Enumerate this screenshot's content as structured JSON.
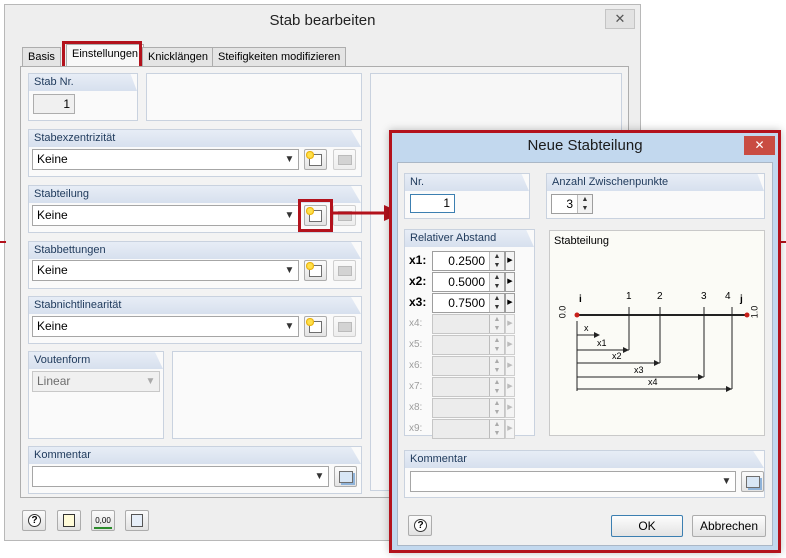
{
  "main_window": {
    "title": "Stab bearbeiten",
    "tabs": [
      {
        "label": "Basis"
      },
      {
        "label": "Einstellungen"
      },
      {
        "label": "Knicklängen"
      },
      {
        "label": "Steifigkeiten modifizieren"
      }
    ],
    "stab_nr": {
      "label": "Stab Nr.",
      "value": "1"
    },
    "stabexzentrizitaet": {
      "label": "Stabexzentrizität",
      "value": "Keine"
    },
    "stabteilung": {
      "label": "Stabteilung",
      "value": "Keine"
    },
    "stabbettungen": {
      "label": "Stabbettungen",
      "value": "Keine"
    },
    "stabnichtlinearitaet": {
      "label": "Stabnichtlinearität",
      "value": "Keine"
    },
    "voutenform": {
      "label": "Voutenform",
      "value": "Linear"
    },
    "kommentar": {
      "label": "Kommentar",
      "value": ""
    },
    "bottom_icons": [
      "help-icon",
      "edit-icon",
      "number-format-icon",
      "pick-icon"
    ],
    "bottom_icon_text": {
      "number_format": "0,00"
    }
  },
  "sub_dialog": {
    "title": "Neue Stabteilung",
    "nr": {
      "label": "Nr.",
      "value": "1"
    },
    "anzahl": {
      "label": "Anzahl Zwischenpunkte",
      "value": "3"
    },
    "relativer_abstand": {
      "label": "Relativer Abstand",
      "rows": [
        {
          "label": "x1:",
          "value": "0.2500",
          "enabled": true
        },
        {
          "label": "x2:",
          "value": "0.5000",
          "enabled": true
        },
        {
          "label": "x3:",
          "value": "0.7500",
          "enabled": true
        },
        {
          "label": "x4:",
          "value": "",
          "enabled": false
        },
        {
          "label": "x5:",
          "value": "",
          "enabled": false
        },
        {
          "label": "x6:",
          "value": "",
          "enabled": false
        },
        {
          "label": "x7:",
          "value": "",
          "enabled": false
        },
        {
          "label": "x8:",
          "value": "",
          "enabled": false
        },
        {
          "label": "x9:",
          "value": "",
          "enabled": false
        }
      ]
    },
    "diagram": {
      "title": "Stabteilung",
      "start_label": "i",
      "end_label": "j",
      "start_value": "0.0",
      "end_value": "1.0",
      "point_labels": [
        "1",
        "2",
        "3",
        "4"
      ],
      "dimension_labels": [
        "x",
        "x1",
        "x2",
        "x3",
        "x4"
      ]
    },
    "kommentar": {
      "label": "Kommentar",
      "value": ""
    },
    "ok_label": "OK",
    "cancel_label": "Abbrechen"
  },
  "colors": {
    "highlight": "#b3121c",
    "group_header": "#dde5f1",
    "dialog_frame": "#c2d8ee"
  }
}
